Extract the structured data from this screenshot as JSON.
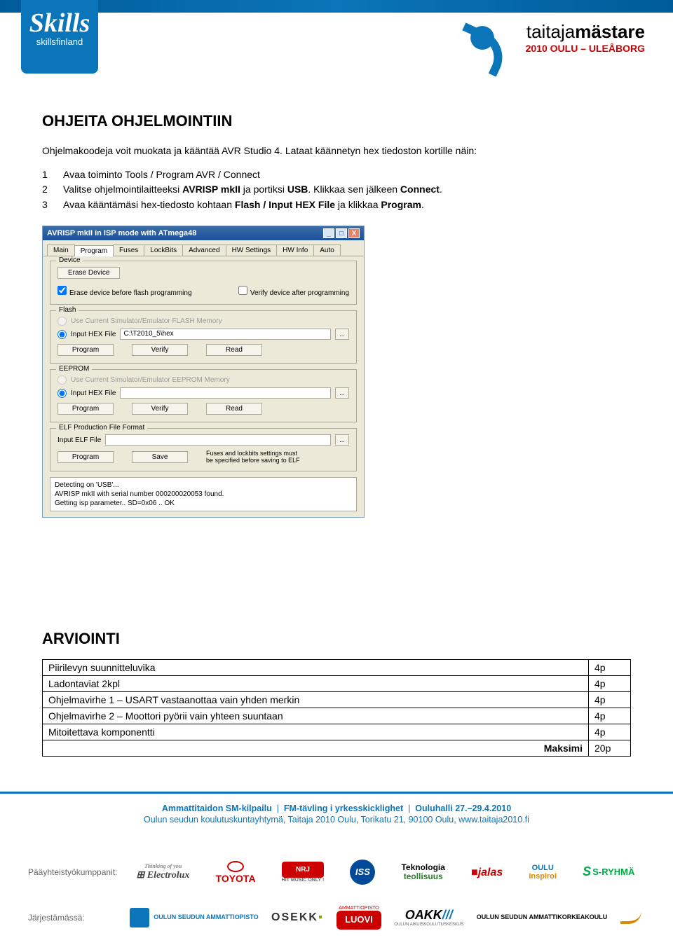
{
  "header": {
    "logo_left_main": "Skills",
    "logo_left_sub": "skillsfinland",
    "logo_right_title_plain": "taitaja",
    "logo_right_title_bold": "mästare",
    "logo_right_subtitle": "2010 OULU – ULEÅBORG"
  },
  "section1": {
    "heading": "OHJEITA OHJELMOINTIIN",
    "intro": "Ohjelmakoodeja voit muokata ja kääntää AVR Studio 4. Lataat käännetyn hex tiedoston kortille näin:",
    "steps": [
      {
        "n": "1",
        "text_a": "Avaa toiminto Tools / Program AVR / Connect"
      },
      {
        "n": "2",
        "text_a": "Valitse ohjelmointilaitteeksi ",
        "b1": "AVRISP mkII",
        "text_b": " ja portiksi ",
        "b2": "USB",
        "text_c": ". Klikkaa sen jälkeen ",
        "b3": "Connect",
        "text_d": "."
      },
      {
        "n": "3",
        "text_a": "Avaa kääntämäsi hex-tiedosto kohtaan ",
        "b1": "Flash / Input HEX File",
        "text_b": " ja klikkaa ",
        "b2": "Program",
        "text_c": "."
      }
    ]
  },
  "window": {
    "title": "AVRISP mkII in ISP mode with ATmega48",
    "ctrl_min": "_",
    "ctrl_max": "□",
    "ctrl_close": "X",
    "tabs": [
      "Main",
      "Program",
      "Fuses",
      "LockBits",
      "Advanced",
      "HW Settings",
      "HW Info",
      "Auto"
    ],
    "active_tab_index": 1,
    "device_group": "Device",
    "erase_btn": "Erase Device",
    "chk1": "Erase device before flash programming",
    "chk2": "Verify device after programming",
    "flash_group": "Flash",
    "flash_radio1": "Use Current Simulator/Emulator FLASH Memory",
    "flash_radio2": "Input HEX File",
    "flash_path": "C:\\T2010_5\\hex",
    "btn_program": "Program",
    "btn_verify": "Verify",
    "btn_read": "Read",
    "eeprom_group": "EEPROM",
    "eeprom_radio1": "Use Current Simulator/Emulator EEPROM Memory",
    "eeprom_radio2": "Input HEX File",
    "elf_group": "ELF Production File Format",
    "elf_label": "Input ELF File",
    "btn_save": "Save",
    "elf_note": "Fuses and lockbits settings must be specified before saving to ELF",
    "log1": "Detecting on 'USB'...",
    "log2": "AVRISP mkII with serial number 000200020053 found.",
    "log3": "Getting isp parameter.. SD=0x06 .. OK"
  },
  "section2": {
    "heading": "ARVIOINTI",
    "rows": [
      {
        "label": "Piirilevyn suunnitteluvika",
        "pts": "4p"
      },
      {
        "label": "Ladontaviat 2kpl",
        "pts": "4p"
      },
      {
        "label": "Ohjelmavirhe 1 – USART vastaanottaa vain yhden merkin",
        "pts": "4p"
      },
      {
        "label": "Ohjelmavirhe 2 – Moottori pyörii vain yhteen suuntaan",
        "pts": "4p"
      },
      {
        "label": "Mitoitettava komponentti",
        "pts": "4p"
      }
    ],
    "total_label": "Maksimi",
    "total_pts": "20p"
  },
  "footer": {
    "line1_parts": [
      "Ammattitaidon SM-kilpailu",
      "FM-tävling i yrkesskicklighet",
      "Ouluhalli 27.–29.4.2010"
    ],
    "line2": "Oulun seudun koulutuskuntayhtymä, Taitaja 2010 Oulu, Torikatu 21, 90100 Oulu, www.taitaja2010.fi",
    "partners_label": "Pääyhteistyökumppanit:",
    "org_label": "Järjestämässä:",
    "p_electrolux_tag": "Thinking of you",
    "p_electrolux": "Electrolux",
    "p_toyota": "TOYOTA",
    "p_nrj": "NRJ",
    "p_nrj_sub": "HIT MUSIC ONLY !",
    "p_iss": "ISS",
    "p_tekno1": "Teknologia",
    "p_tekno2": "teollisuus",
    "p_jalas": "jalas",
    "p_oulu1": "OULU",
    "p_oulu2": "inspiroi",
    "p_sryhma": "S-RYHMÄ",
    "p_osao": "OULUN SEUDUN AMMATTIOPISTO",
    "p_osekk": "OSEKK",
    "p_luovi": "LUOVI",
    "p_luovi_sup": "AMMATTIOPISTO",
    "p_oakk": "OAKK",
    "p_oakk_sub": "OULUN AIKUISKOULUTUSKESKUS",
    "p_oamk": "OULUN SEUDUN AMMATTIKORKEAKOULU"
  }
}
